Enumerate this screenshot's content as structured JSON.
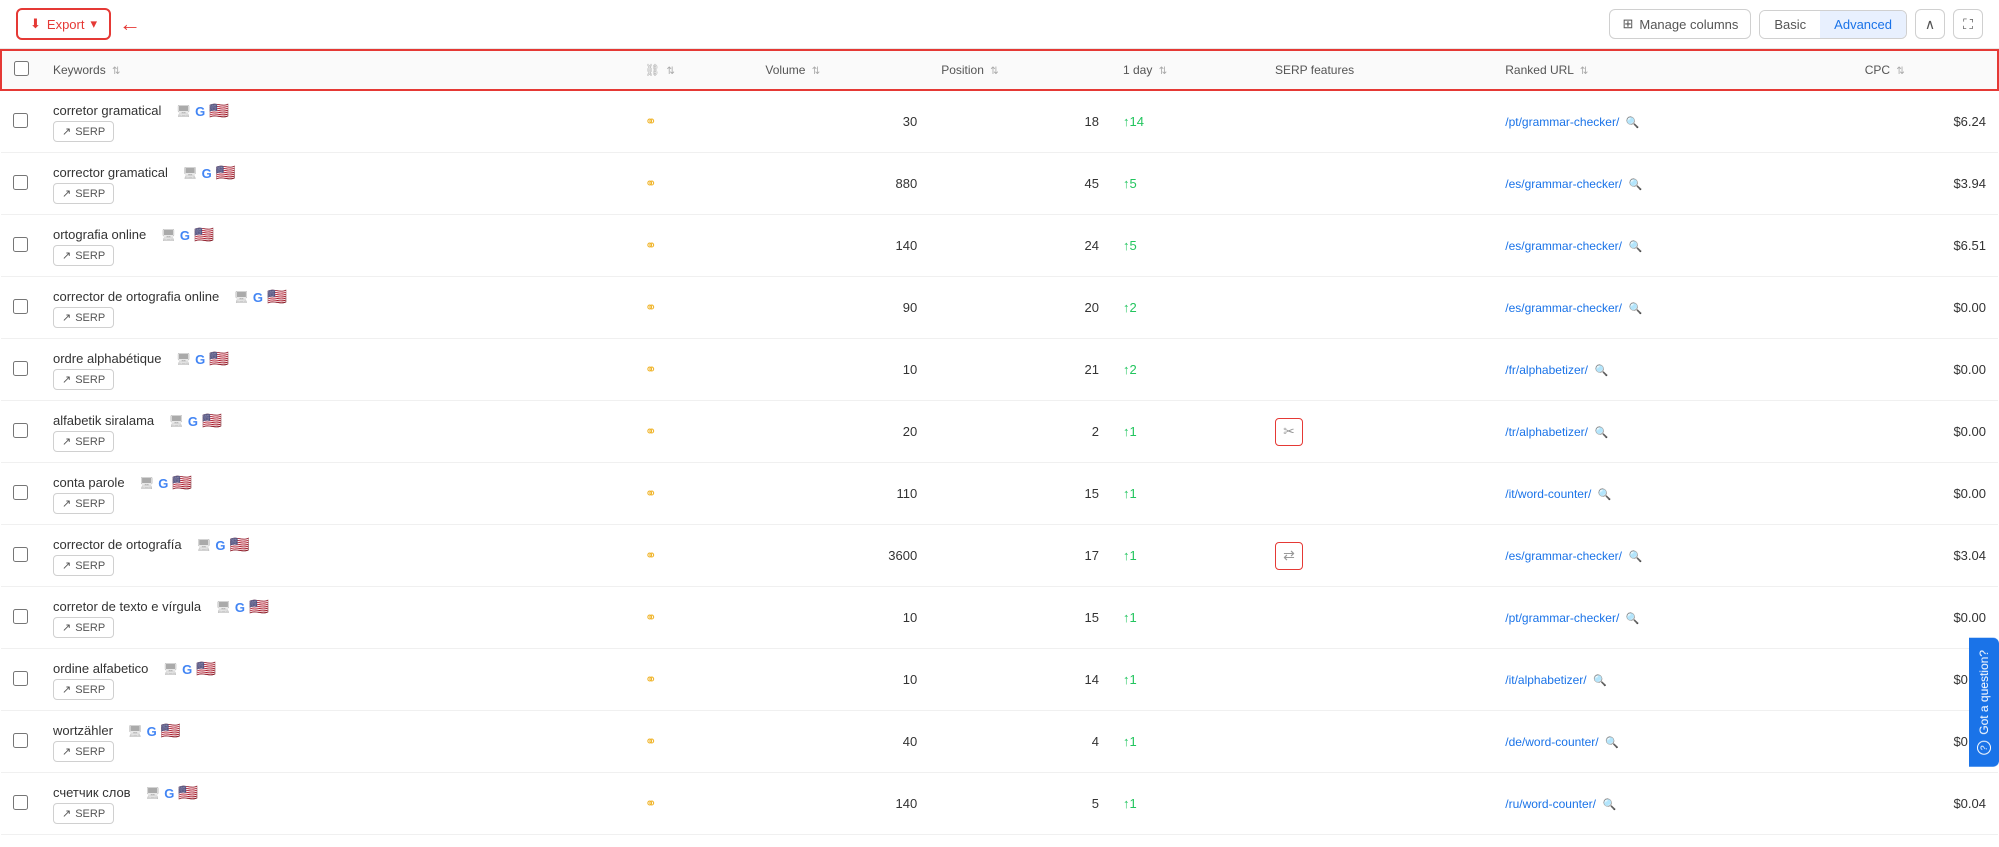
{
  "toolbar": {
    "export_label": "Export",
    "manage_columns_label": "Manage columns",
    "view_basic_label": "Basic",
    "view_advanced_label": "Advanced",
    "collapse_icon": "∧",
    "expand_icon": "⛶"
  },
  "table": {
    "columns": [
      {
        "key": "checkbox",
        "label": ""
      },
      {
        "key": "keyword",
        "label": "Keywords",
        "sortable": true
      },
      {
        "key": "link",
        "label": "",
        "icon": "link"
      },
      {
        "key": "volume",
        "label": "Volume",
        "sortable": true
      },
      {
        "key": "position",
        "label": "Position",
        "sortable": true
      },
      {
        "key": "day1",
        "label": "1 day",
        "sortable": true
      },
      {
        "key": "serp_features",
        "label": "SERP features"
      },
      {
        "key": "ranked_url",
        "label": "Ranked URL",
        "sortable": true
      },
      {
        "key": "cpc",
        "label": "CPC",
        "sortable": true
      }
    ],
    "rows": [
      {
        "keyword": "corretor gramatical",
        "volume": "30",
        "position": "18",
        "day1": "+14",
        "day1_dir": "up",
        "serp_feature": null,
        "ranked_url": "/pt/grammar-checker/",
        "cpc": "$6.24"
      },
      {
        "keyword": "corrector gramatical",
        "volume": "880",
        "position": "45",
        "day1": "+5",
        "day1_dir": "up",
        "serp_feature": null,
        "ranked_url": "/es/grammar-checker/",
        "cpc": "$3.94"
      },
      {
        "keyword": "ortografia online",
        "volume": "140",
        "position": "24",
        "day1": "+5",
        "day1_dir": "up",
        "serp_feature": null,
        "ranked_url": "/es/grammar-checker/",
        "cpc": "$6.51"
      },
      {
        "keyword": "corrector de ortografia online",
        "volume": "90",
        "position": "20",
        "day1": "+2",
        "day1_dir": "up",
        "serp_feature": null,
        "ranked_url": "/es/grammar-checker/",
        "cpc": "$0.00"
      },
      {
        "keyword": "ordre alphabétique",
        "volume": "10",
        "position": "21",
        "day1": "+2",
        "day1_dir": "up",
        "serp_feature": null,
        "ranked_url": "/fr/alphabetizer/",
        "cpc": "$0.00"
      },
      {
        "keyword": "alfabetik siralama",
        "volume": "20",
        "position": "2",
        "day1": "+1",
        "day1_dir": "up",
        "serp_feature": "scissors",
        "ranked_url": "/tr/alphabetizer/",
        "cpc": "$0.00"
      },
      {
        "keyword": "conta parole",
        "volume": "110",
        "position": "15",
        "day1": "+1",
        "day1_dir": "up",
        "serp_feature": null,
        "ranked_url": "/it/word-counter/",
        "cpc": "$0.00"
      },
      {
        "keyword": "corrector de ortografía",
        "volume": "3600",
        "position": "17",
        "day1": "+1",
        "day1_dir": "up",
        "serp_feature": "transfer",
        "ranked_url": "/es/grammar-checker/",
        "cpc": "$3.04"
      },
      {
        "keyword": "corretor de texto e vírgula",
        "volume": "10",
        "position": "15",
        "day1": "+1",
        "day1_dir": "up",
        "serp_feature": null,
        "ranked_url": "/pt/grammar-checker/",
        "cpc": "$0.00"
      },
      {
        "keyword": "ordine alfabetico",
        "volume": "10",
        "position": "14",
        "day1": "+1",
        "day1_dir": "up",
        "serp_feature": null,
        "ranked_url": "/it/alphabetizer/",
        "cpc": "$0.00"
      },
      {
        "keyword": "wortzähler",
        "volume": "40",
        "position": "4",
        "day1": "+1",
        "day1_dir": "up",
        "serp_feature": null,
        "ranked_url": "/de/word-counter/",
        "cpc": "$0.00"
      },
      {
        "keyword": "счетчик слов",
        "volume": "140",
        "position": "5",
        "day1": "+1",
        "day1_dir": "up",
        "serp_feature": null,
        "ranked_url": "/ru/word-counter/",
        "cpc": "$0.04"
      }
    ]
  },
  "help_btn": {
    "label": "Got a question?",
    "icon": "?"
  }
}
